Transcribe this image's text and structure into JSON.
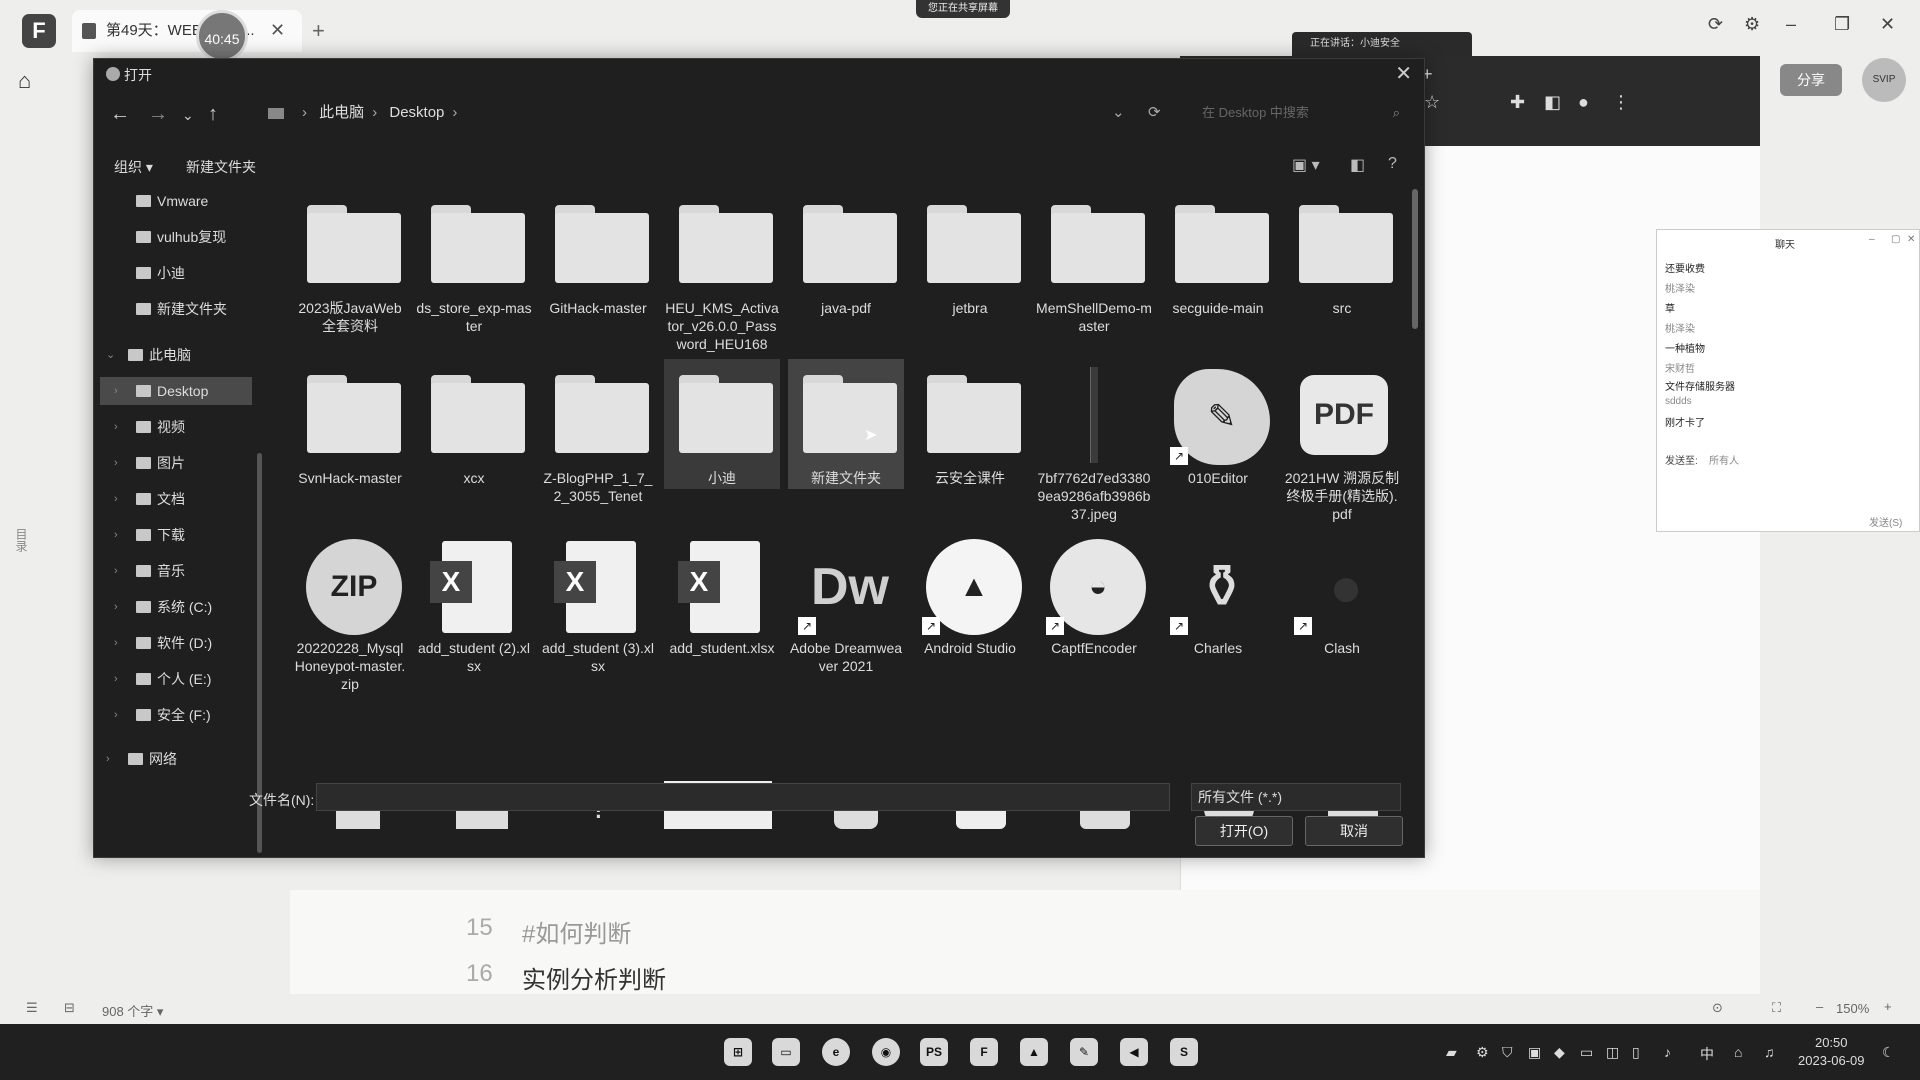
{
  "app": {
    "tab_title": "第49天：WEB",
    "tab_ellipsis": "...",
    "timer": "40:45",
    "sharing_banner": "您正在共享屏幕"
  },
  "background": {
    "speaking": "正在讲话：小迪安全",
    "share_button": "分享",
    "svip": "SVIP",
    "side_label": "目录"
  },
  "chat": {
    "title": "聊天",
    "lines": [
      "还要收费",
      "桃泽染",
      "草",
      "桃泽染",
      "一种植物",
      "宋财哲",
      "文件存储服务器",
      "sddds",
      "刚才卡了"
    ],
    "send_to_label": "发送至:",
    "send_to_value": "所有人",
    "send_button": "发送(S)"
  },
  "dialog": {
    "title": "打开",
    "breadcrumb": [
      "此电脑",
      "Desktop"
    ],
    "search_placeholder": "在 Desktop 中搜索",
    "organize": "组织 ▾",
    "new_folder": "新建文件夹",
    "nav": [
      {
        "label": "Vmware",
        "indent": 1
      },
      {
        "label": "vulhub复现",
        "indent": 1
      },
      {
        "label": "小迪",
        "indent": 1
      },
      {
        "label": "新建文件夹",
        "indent": 1
      },
      {
        "label": "此电脑",
        "indent": 0
      },
      {
        "label": "Desktop",
        "indent": 1
      },
      {
        "label": "视频",
        "indent": 1
      },
      {
        "label": "图片",
        "indent": 1
      },
      {
        "label": "文档",
        "indent": 1
      },
      {
        "label": "下载",
        "indent": 1
      },
      {
        "label": "音乐",
        "indent": 1
      },
      {
        "label": "系统 (C:)",
        "indent": 1
      },
      {
        "label": "软件 (D:)",
        "indent": 1
      },
      {
        "label": "个人 (E:)",
        "indent": 1
      },
      {
        "label": "安全 (F:)",
        "indent": 1
      },
      {
        "label": "网络",
        "indent": 0
      }
    ],
    "files_row1": [
      "2023版JavaWeb全套资料",
      "ds_store_exp-master",
      "GitHack-master",
      "HEU_KMS_Activator_v26.0.0_Password_HEU168",
      "java-pdf",
      "jetbra",
      "MemShellDemo-master",
      "secguide-main",
      "src"
    ],
    "files_row2": [
      "SvnHack-master",
      "xcx",
      "Z-BlogPHP_1_7_2_3055_Tenet",
      "小迪",
      "新建文件夹",
      "云安全课件",
      "7bf7762d7ed33809ea9286afb3986b37.jpeg",
      "010Editor",
      "2021HW  溯源反制终极手册(精选版).pdf"
    ],
    "files_row3": [
      "20220228_MysqlHoneypot-master.zip",
      "add_student (2).xlsx",
      "add_student (3).xlsx",
      "add_student.xlsx",
      "Adobe Dreamweaver 2021",
      "Android Studio",
      "CaptfEncoder",
      "Charles",
      "Clash"
    ],
    "icon_text": {
      "zip": "ZIP",
      "x": "X",
      "dw": "Dw",
      "pdf": "PDF"
    },
    "filename_label": "文件名(N):",
    "filter": "所有文件 (*.*)",
    "open_button": "打开(O)",
    "cancel_button": "取消"
  },
  "document": {
    "lines": [
      {
        "num": "15",
        "text": "#如何判断"
      },
      {
        "num": "16",
        "text": "实例分析判断"
      }
    ],
    "word_count": "908 个字 ▾",
    "zoom": "150%"
  },
  "taskbar": {
    "time": "20:50",
    "date": "2023-06-09",
    "ime": "中"
  }
}
